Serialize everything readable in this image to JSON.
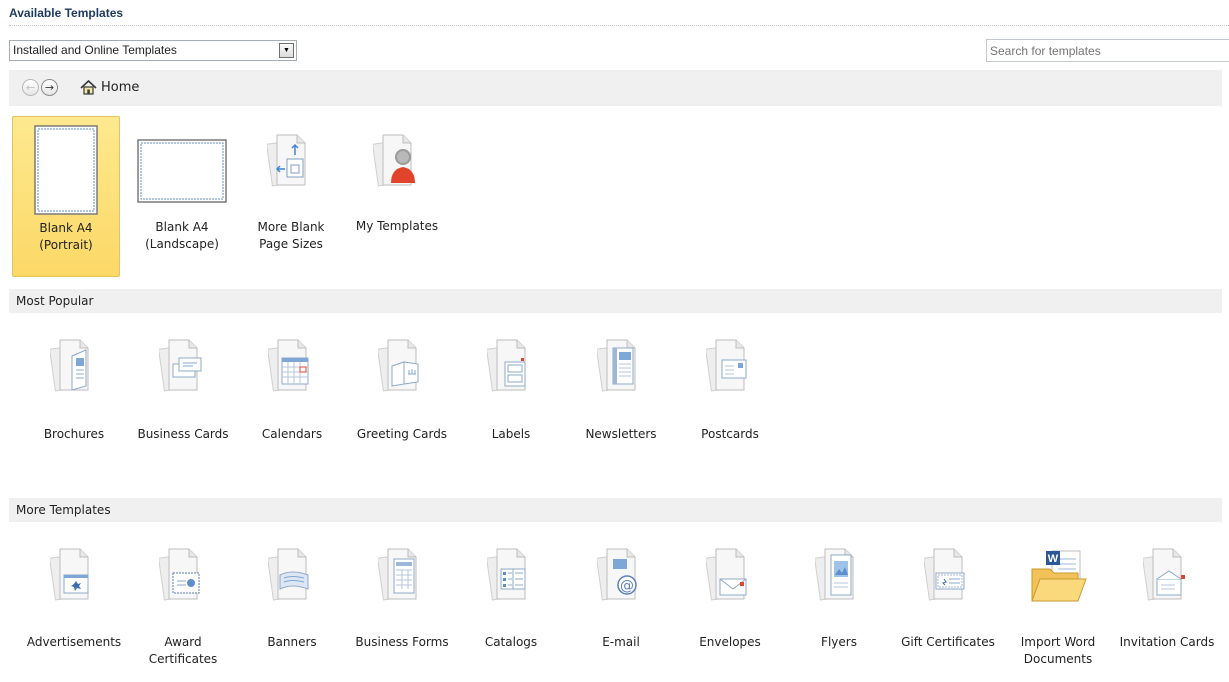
{
  "header": {
    "title": "Available Templates"
  },
  "filter": {
    "selected": "Installed and Online Templates",
    "arrow": "▼"
  },
  "search": {
    "placeholder": "Search for templates"
  },
  "nav": {
    "back": "←",
    "forward": "→",
    "home_label": "Home"
  },
  "blank_templates": [
    {
      "label": "Blank A4\n(Portrait)",
      "icon": "blank-portrait-icon",
      "selected": true
    },
    {
      "label": "Blank A4\n(Landscape)",
      "icon": "blank-landscape-icon",
      "selected": false
    },
    {
      "label": "More Blank\nPage Sizes",
      "icon": "page-sizes-icon",
      "selected": false
    },
    {
      "label": "My Templates",
      "icon": "my-templates-icon",
      "selected": false
    }
  ],
  "sections": {
    "most_popular": {
      "title": "Most Popular",
      "items": [
        {
          "label": "Brochures",
          "icon": "brochure-icon"
        },
        {
          "label": "Business Cards",
          "icon": "business-card-icon"
        },
        {
          "label": "Calendars",
          "icon": "calendar-icon"
        },
        {
          "label": "Greeting Cards",
          "icon": "greeting-card-icon"
        },
        {
          "label": "Labels",
          "icon": "labels-icon"
        },
        {
          "label": "Newsletters",
          "icon": "newsletter-icon"
        },
        {
          "label": "Postcards",
          "icon": "postcard-icon"
        }
      ]
    },
    "more_templates": {
      "title": "More Templates",
      "items": [
        {
          "label": "Advertisements",
          "icon": "advertisement-icon"
        },
        {
          "label": "Award\nCertificates",
          "icon": "award-certificate-icon"
        },
        {
          "label": "Banners",
          "icon": "banner-icon"
        },
        {
          "label": "Business Forms",
          "icon": "business-form-icon"
        },
        {
          "label": "Catalogs",
          "icon": "catalog-icon"
        },
        {
          "label": "E-mail",
          "icon": "email-icon"
        },
        {
          "label": "Envelopes",
          "icon": "envelope-icon"
        },
        {
          "label": "Flyers",
          "icon": "flyer-icon"
        },
        {
          "label": "Gift Certificates",
          "icon": "gift-certificate-icon"
        },
        {
          "label": "Import Word\nDocuments",
          "icon": "word-folder-icon"
        },
        {
          "label": "Invitation Cards",
          "icon": "invitation-card-icon"
        }
      ]
    }
  },
  "colors": {
    "accent": "#fcd866",
    "section_bg": "#f0f0f0",
    "icon_blue": "#5d8fc9",
    "icon_red": "#e0452b"
  }
}
